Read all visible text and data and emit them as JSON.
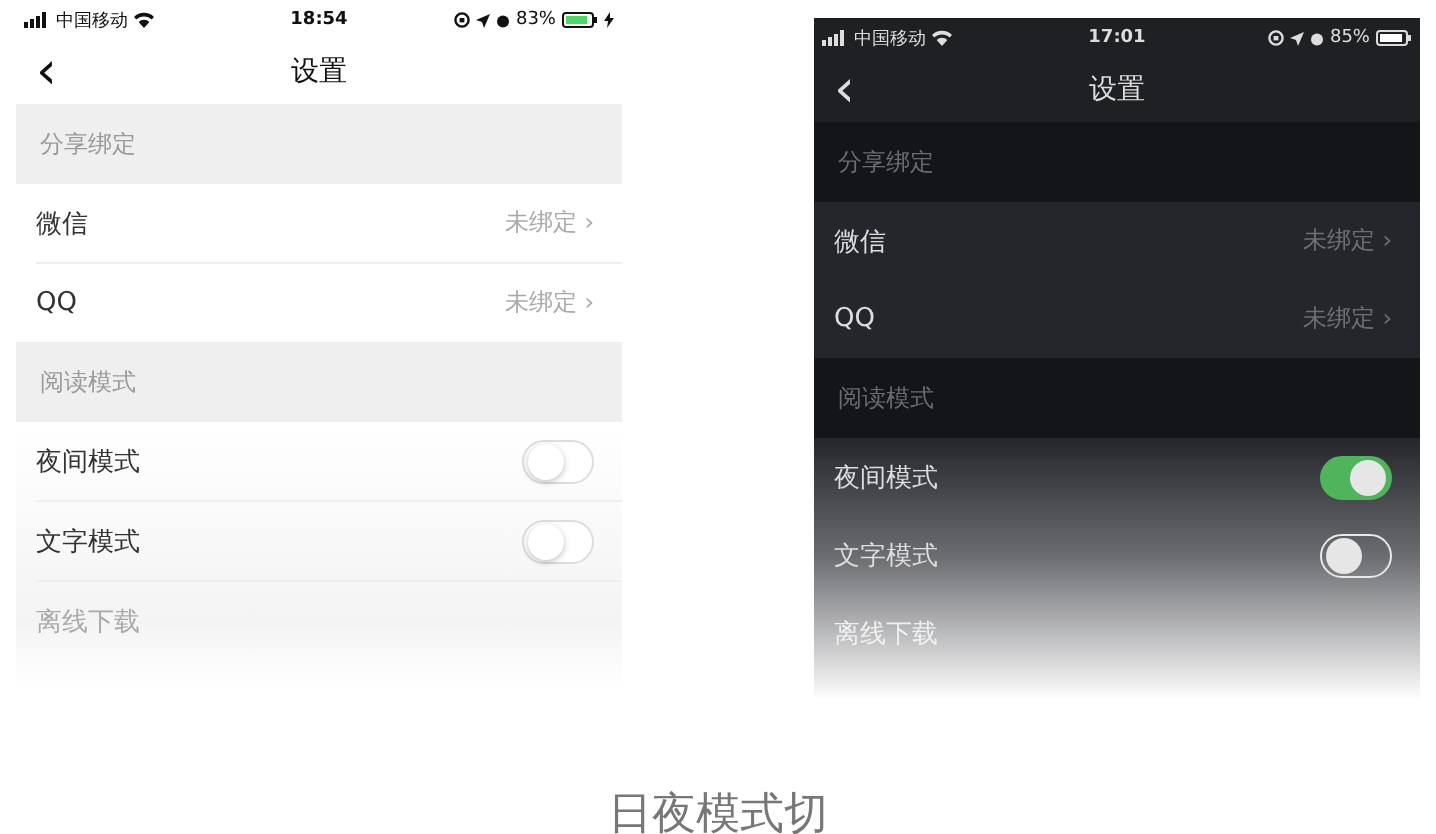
{
  "screens": [
    {
      "kind": "light",
      "status": {
        "carrier": "中国移动",
        "time": "18:54",
        "battery": "83%",
        "charging": true
      },
      "title": "设置",
      "back": "‹",
      "sections": [
        {
          "header": "分享绑定",
          "rows": [
            {
              "kind": "link",
              "label": "微信",
              "value": "未绑定 ›"
            },
            {
              "kind": "link",
              "label": "QQ",
              "value": "未绑定 ›"
            }
          ]
        },
        {
          "header": "阅读模式",
          "rows": [
            {
              "kind": "toggle",
              "label": "夜间模式",
              "on": false
            },
            {
              "kind": "toggle",
              "label": "文字模式",
              "on": false
            },
            {
              "kind": "plain",
              "label": "离线下载"
            }
          ]
        }
      ]
    },
    {
      "kind": "dark",
      "status": {
        "carrier": "中国移动",
        "time": "17:01",
        "battery": "85%"
      },
      "title": "设置",
      "back": "‹",
      "sections": [
        {
          "header": "分享绑定",
          "rows": [
            {
              "kind": "link",
              "label": "微信",
              "value": "未绑定 ›"
            },
            {
              "kind": "link",
              "label": "QQ",
              "value": "未绑定 ›"
            }
          ]
        },
        {
          "header": "阅读模式",
          "rows": [
            {
              "kind": "toggle",
              "label": "夜间模式",
              "on": true
            },
            {
              "kind": "toggle",
              "label": "文字模式",
              "on": false
            },
            {
              "kind": "plain",
              "label": "离线下载"
            }
          ]
        }
      ]
    }
  ],
  "caption": "日夜模式切"
}
